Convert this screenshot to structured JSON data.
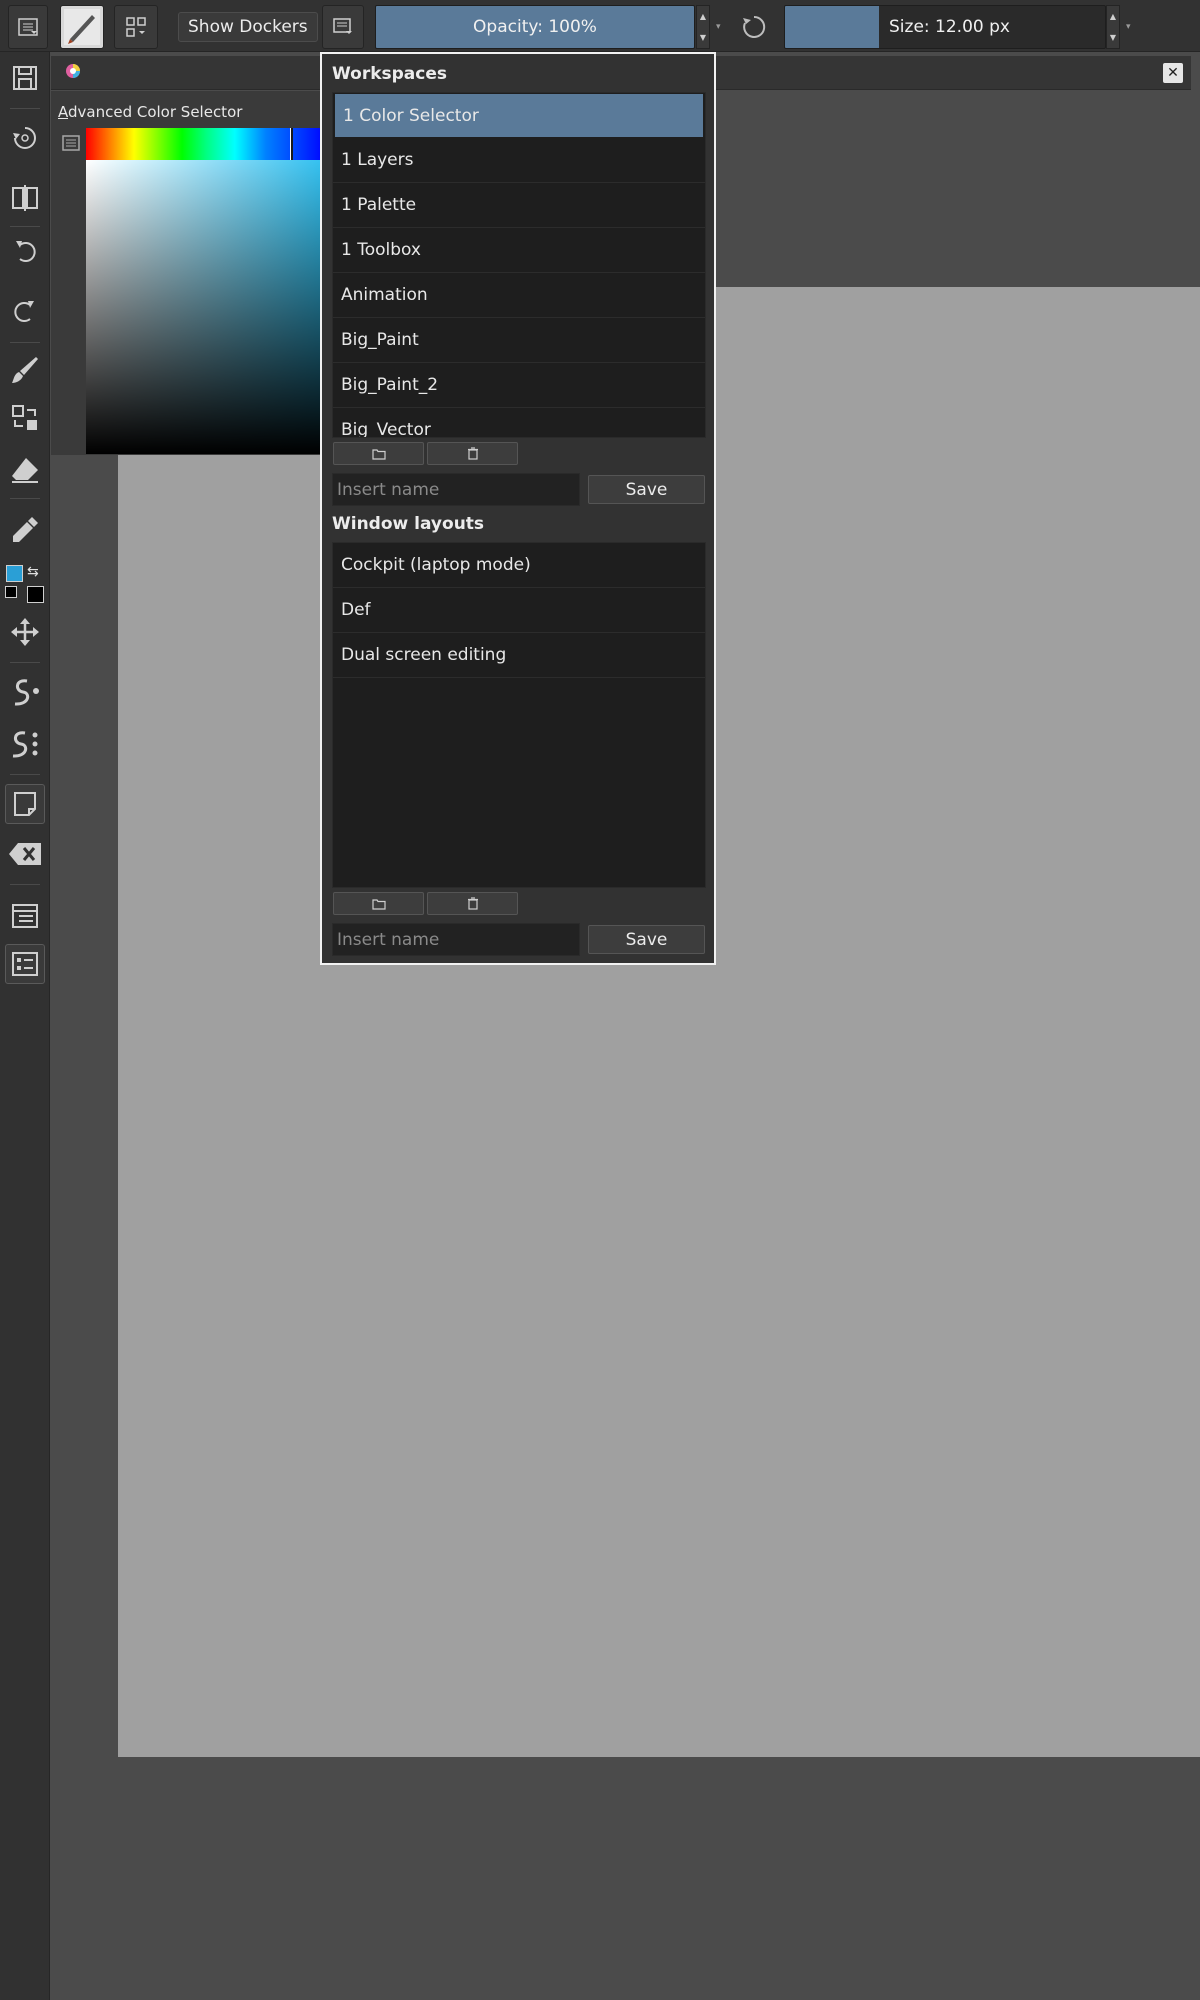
{
  "toolbar": {
    "show_dockers_label": "Show Dockers",
    "opacity_label": "Opacity: 100%",
    "opacity_value": 100,
    "size_label": "Size: 12.00 px"
  },
  "docker": {
    "title": "Advanced Color Selector",
    "title_mnemonic": "A",
    "title_rest": "dvanced Color Selector"
  },
  "workspaces": {
    "title": "Workspaces",
    "items": [
      "1 Color Selector",
      "1 Layers",
      "1 Palette",
      "1 Toolbox",
      "Animation",
      "Big_Paint",
      "Big_Paint_2",
      "Big_Vector"
    ],
    "selected": "1 Color Selector",
    "input_placeholder": "Insert name",
    "save_label": "Save"
  },
  "window_layouts": {
    "title": "Window layouts",
    "items": [
      "Cockpit (laptop mode)",
      "Def",
      "Dual screen editing"
    ],
    "input_placeholder": "Insert name",
    "save_label": "Save"
  },
  "colors": {
    "accent": "#5a7a99",
    "foreground_color": "#2a9fd6",
    "background_color": "#000000"
  }
}
